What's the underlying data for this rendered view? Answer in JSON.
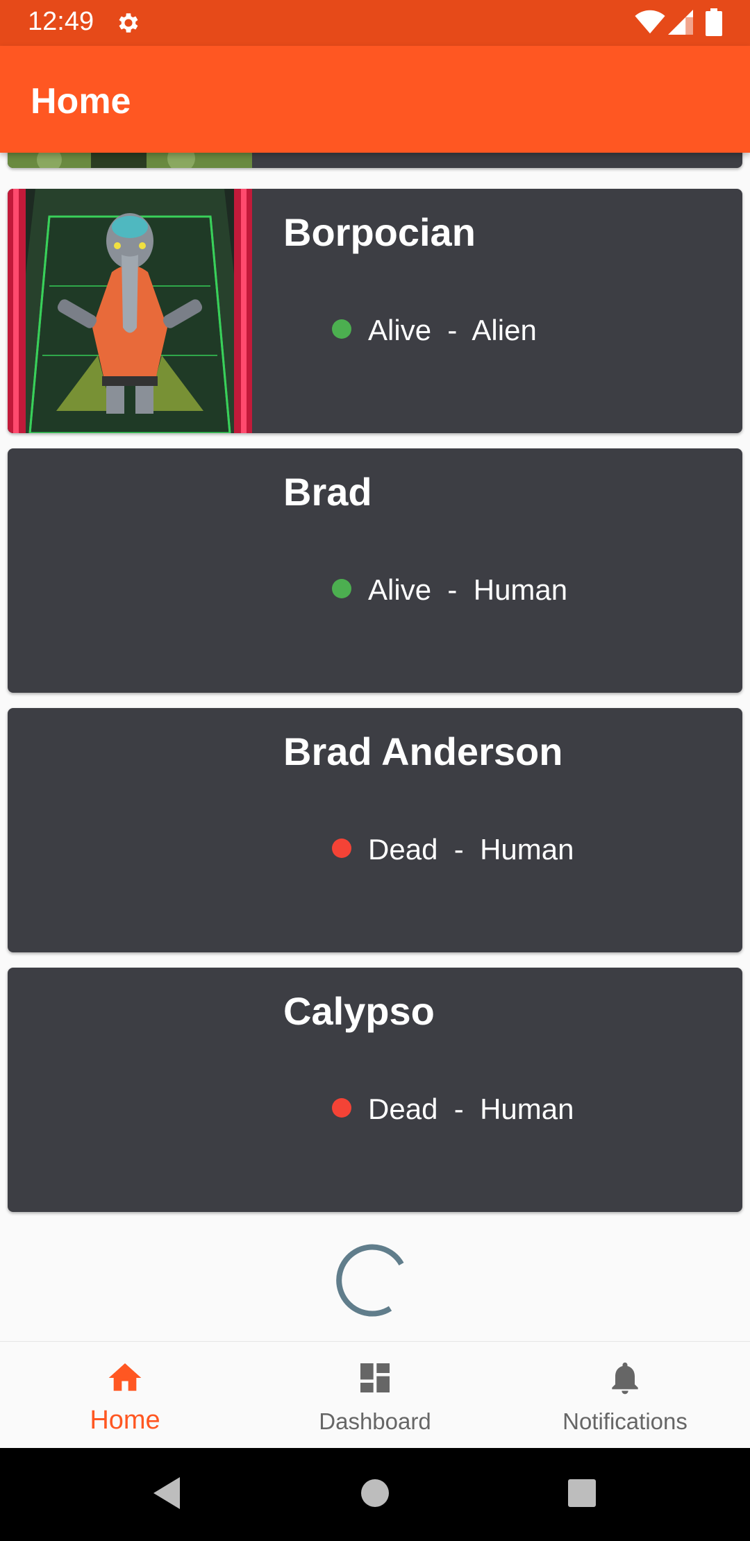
{
  "status_bar": {
    "time": "12:49",
    "icons": [
      "gear-icon",
      "wifi-icon",
      "signal-icon",
      "battery-icon"
    ],
    "color": "#e64a19"
  },
  "app_bar": {
    "title": "Home",
    "color": "#ff5722"
  },
  "characters": [
    {
      "name": "Borpocian",
      "status": "Alive",
      "species": "Alien",
      "status_color": "#4caf50",
      "has_image": true
    },
    {
      "name": "Brad",
      "status": "Alive",
      "species": "Human",
      "status_color": "#4caf50",
      "has_image": false
    },
    {
      "name": "Brad Anderson",
      "status": "Dead",
      "species": "Human",
      "status_color": "#f44336",
      "has_image": false
    },
    {
      "name": "Calypso",
      "status": "Dead",
      "species": "Human",
      "status_color": "#f44336",
      "has_image": false
    }
  ],
  "status_separator": "  -  ",
  "loading_icon": "progress-spinner-icon",
  "bottom_nav": {
    "items": [
      {
        "label": "Home",
        "icon": "home-icon",
        "active": true
      },
      {
        "label": "Dashboard",
        "icon": "dashboard-icon",
        "active": false
      },
      {
        "label": "Notifications",
        "icon": "bell-icon",
        "active": false
      }
    ],
    "active_color": "#ff5722"
  },
  "system_nav": {
    "buttons": [
      "back-icon",
      "home-circle-icon",
      "recents-icon"
    ]
  }
}
